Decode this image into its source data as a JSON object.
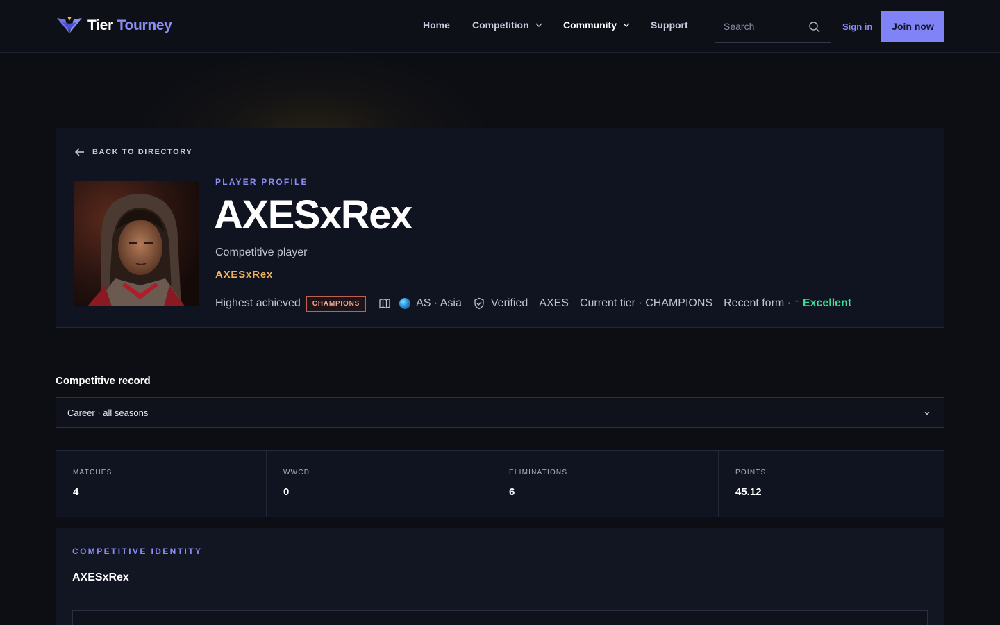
{
  "brand": {
    "name_part1": "Tier",
    "name_part2": "Tourney",
    "accent": "#8b8cf6"
  },
  "nav": {
    "home": "Home",
    "competition": "Competition",
    "community": "Community",
    "support": "Support"
  },
  "search": {
    "placeholder": "Search"
  },
  "auth": {
    "signin": "Sign in",
    "join": "Join now"
  },
  "profile": {
    "back": "BACK TO DIRECTORY",
    "eyebrow": "PLAYER PROFILE",
    "name": "AXESxRex",
    "role": "Competitive player",
    "tag": "AXESxRex",
    "highest_label": "Highest achieved",
    "highest_badge": "CHAMPIONS",
    "region": "AS · Asia",
    "verified": "Verified",
    "team": "AXES",
    "current_tier": "Current tier · CHAMPIONS",
    "recent_form_label": "Recent form · ",
    "recent_form_arrow": "↑",
    "recent_form_value": "Excellent",
    "form_color": "#3ddc97"
  },
  "record": {
    "title": "Competitive record",
    "selected": "Career · all seasons",
    "stats": [
      {
        "label": "MATCHES",
        "value": "4"
      },
      {
        "label": "WWCD",
        "value": "0"
      },
      {
        "label": "ELIMINATIONS",
        "value": "6"
      },
      {
        "label": "POINTS",
        "value": "45.12"
      }
    ]
  },
  "identity": {
    "eyebrow": "COMPETITIVE IDENTITY",
    "name": "AXESxRex"
  }
}
